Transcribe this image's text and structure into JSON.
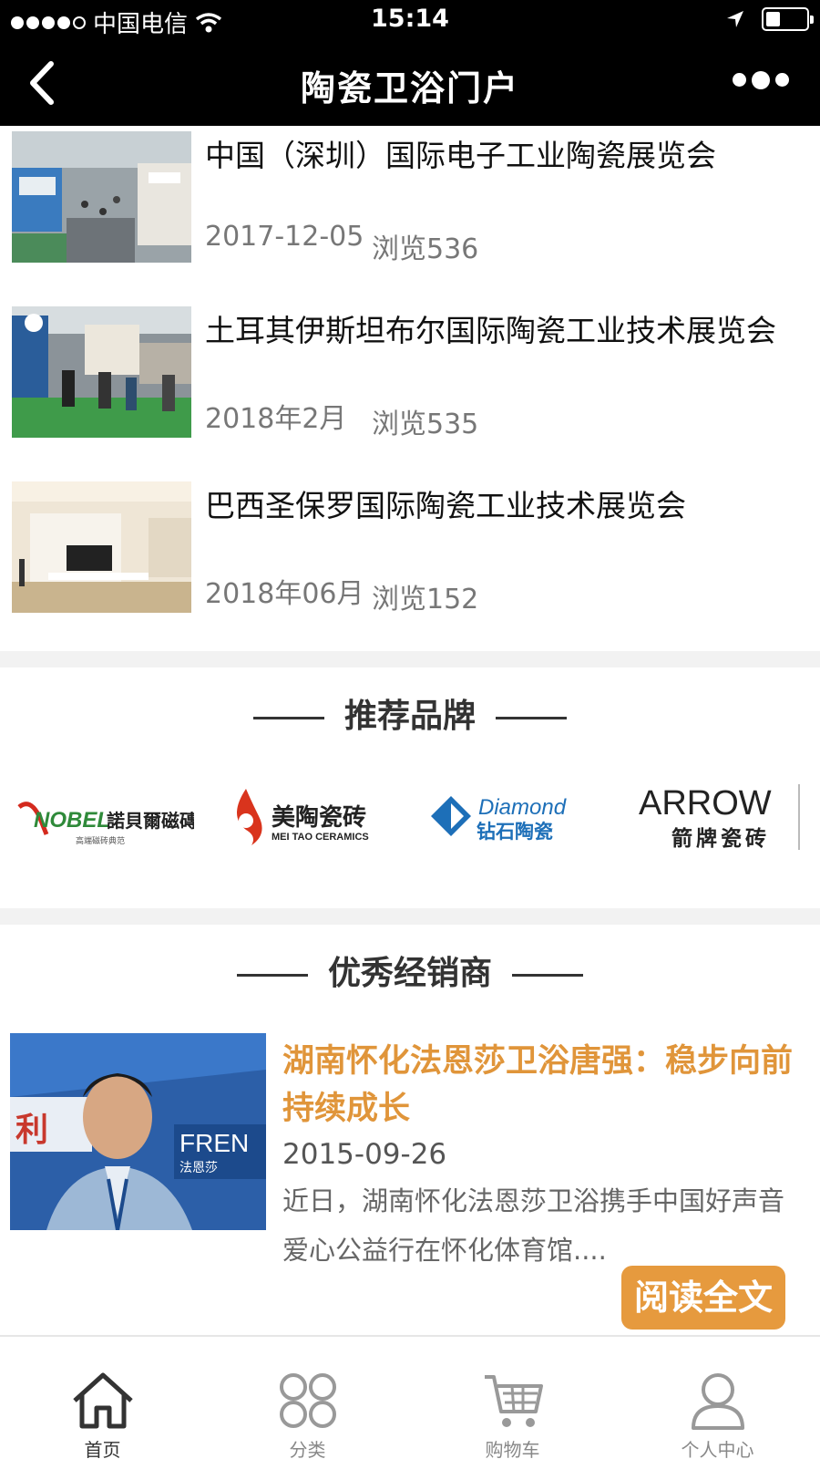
{
  "status_bar": {
    "carrier": "中国电信",
    "time": "15:14",
    "battery_level": 0.35
  },
  "nav": {
    "title": "陶瓷卫浴门户",
    "back_icon": "chevron-left-icon",
    "more_icon": "more-dots-icon"
  },
  "news": [
    {
      "title": "中国（深圳）国际电子工业陶瓷展览会",
      "date": "2017-12-05",
      "views": "浏览536"
    },
    {
      "title": "土耳其伊斯坦布尔国际陶瓷工业技术展览会",
      "date": "2018年2月",
      "views": "浏览535"
    },
    {
      "title": "巴西圣保罗国际陶瓷工业技术展览会",
      "date": "2018年06月",
      "views": "浏览152"
    }
  ],
  "brands_section": {
    "title": "推荐品牌",
    "brands": [
      {
        "name_en": "NOBEL",
        "name_cn": "諾貝爾磁磚",
        "sub": "高端磁砖典范",
        "color": "#d42a1e"
      },
      {
        "name_en": "MEI TAO CERAMICS",
        "name_cn": "美陶瓷砖",
        "color": "#d9341d"
      },
      {
        "name_en": "Diamond",
        "name_cn": "钻石陶瓷",
        "color": "#1d6fb8"
      },
      {
        "name_en": "ARROW",
        "name_cn": "箭牌瓷砖",
        "color": "#222222"
      }
    ]
  },
  "dealers_section": {
    "title": "优秀经销商",
    "article": {
      "title": "湖南怀化法恩莎卫浴唐强：稳步向前 持续成长",
      "date": "2015-09-26",
      "excerpt": "近日，湖南怀化法恩莎卫浴携手中国好声音爱心公益行在怀化体育馆....",
      "read_more": "阅读全文"
    },
    "accent_color": "#e69a3e"
  },
  "tab_bar": {
    "tabs": [
      {
        "label": "首页",
        "icon": "home-icon",
        "active": true
      },
      {
        "label": "分类",
        "icon": "category-icon",
        "active": false
      },
      {
        "label": "购物车",
        "icon": "cart-icon",
        "active": false
      },
      {
        "label": "个人中心",
        "icon": "user-icon",
        "active": false
      }
    ]
  }
}
